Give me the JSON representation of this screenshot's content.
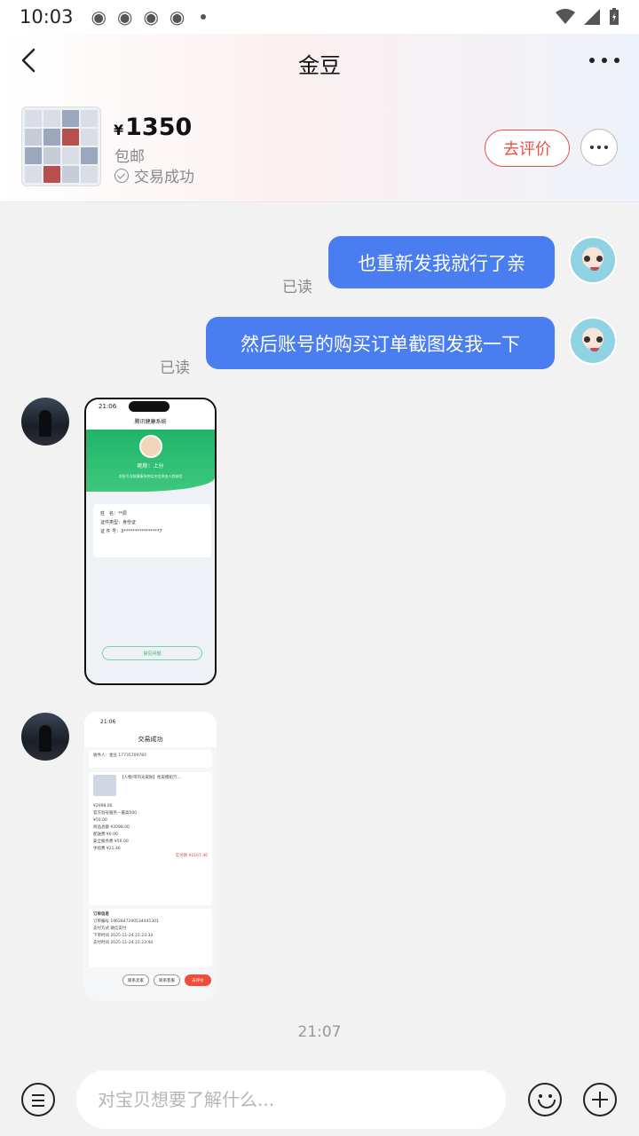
{
  "status": {
    "time": "10:03"
  },
  "header": {
    "title": "金豆",
    "product": {
      "currency": "¥",
      "price": "1350",
      "shipping": "包邮",
      "trade_status": "交易成功"
    },
    "rate_button": "去评价"
  },
  "messages": [
    {
      "from": "me",
      "text": "也重新发我就行了亲",
      "read": "已读"
    },
    {
      "from": "me",
      "text": "然后账号的购买订单截图发我一下",
      "read": "已读"
    }
  ],
  "shot1": {
    "time": "21:06",
    "app_title": "腾讯健康系统",
    "nickname": "昵称：上分",
    "subtitle": "本账号当前健康系统实名信息由人脸核验",
    "rows": [
      "姓　名：**辰",
      "证件类型：身份证",
      "证 件 号：3****************7"
    ],
    "button": "常见问题"
  },
  "shot2": {
    "time": "21:06",
    "title": "交易成功",
    "receiver": "收件人：金豆 17735709783",
    "item": "【人物/带内光皮肤】枪皮模组万…",
    "item_price": "¥2098.00",
    "service": "官方验号服务—最高500",
    "service_price": "¥50.00",
    "fees": [
      "商品总额 ¥2098.00",
      "配送费 ¥0.00",
      "安全服务费 ¥50.00",
      "手续费 ¥21.46"
    ],
    "paid": "实付款 ¥2167.46",
    "order_title": "订单信息",
    "order_rows": [
      "订单编号 1962847290534445301",
      "支付方式 微信支付",
      "下单时间 2025-11-24 21:23:34",
      "支付时间 2025-11-24 21:23:44"
    ],
    "buttons": [
      "联系卖家",
      "联系客服",
      "去评价"
    ]
  },
  "timestamp": "21:07",
  "input": {
    "placeholder": "对宝贝想要了解什么..."
  }
}
